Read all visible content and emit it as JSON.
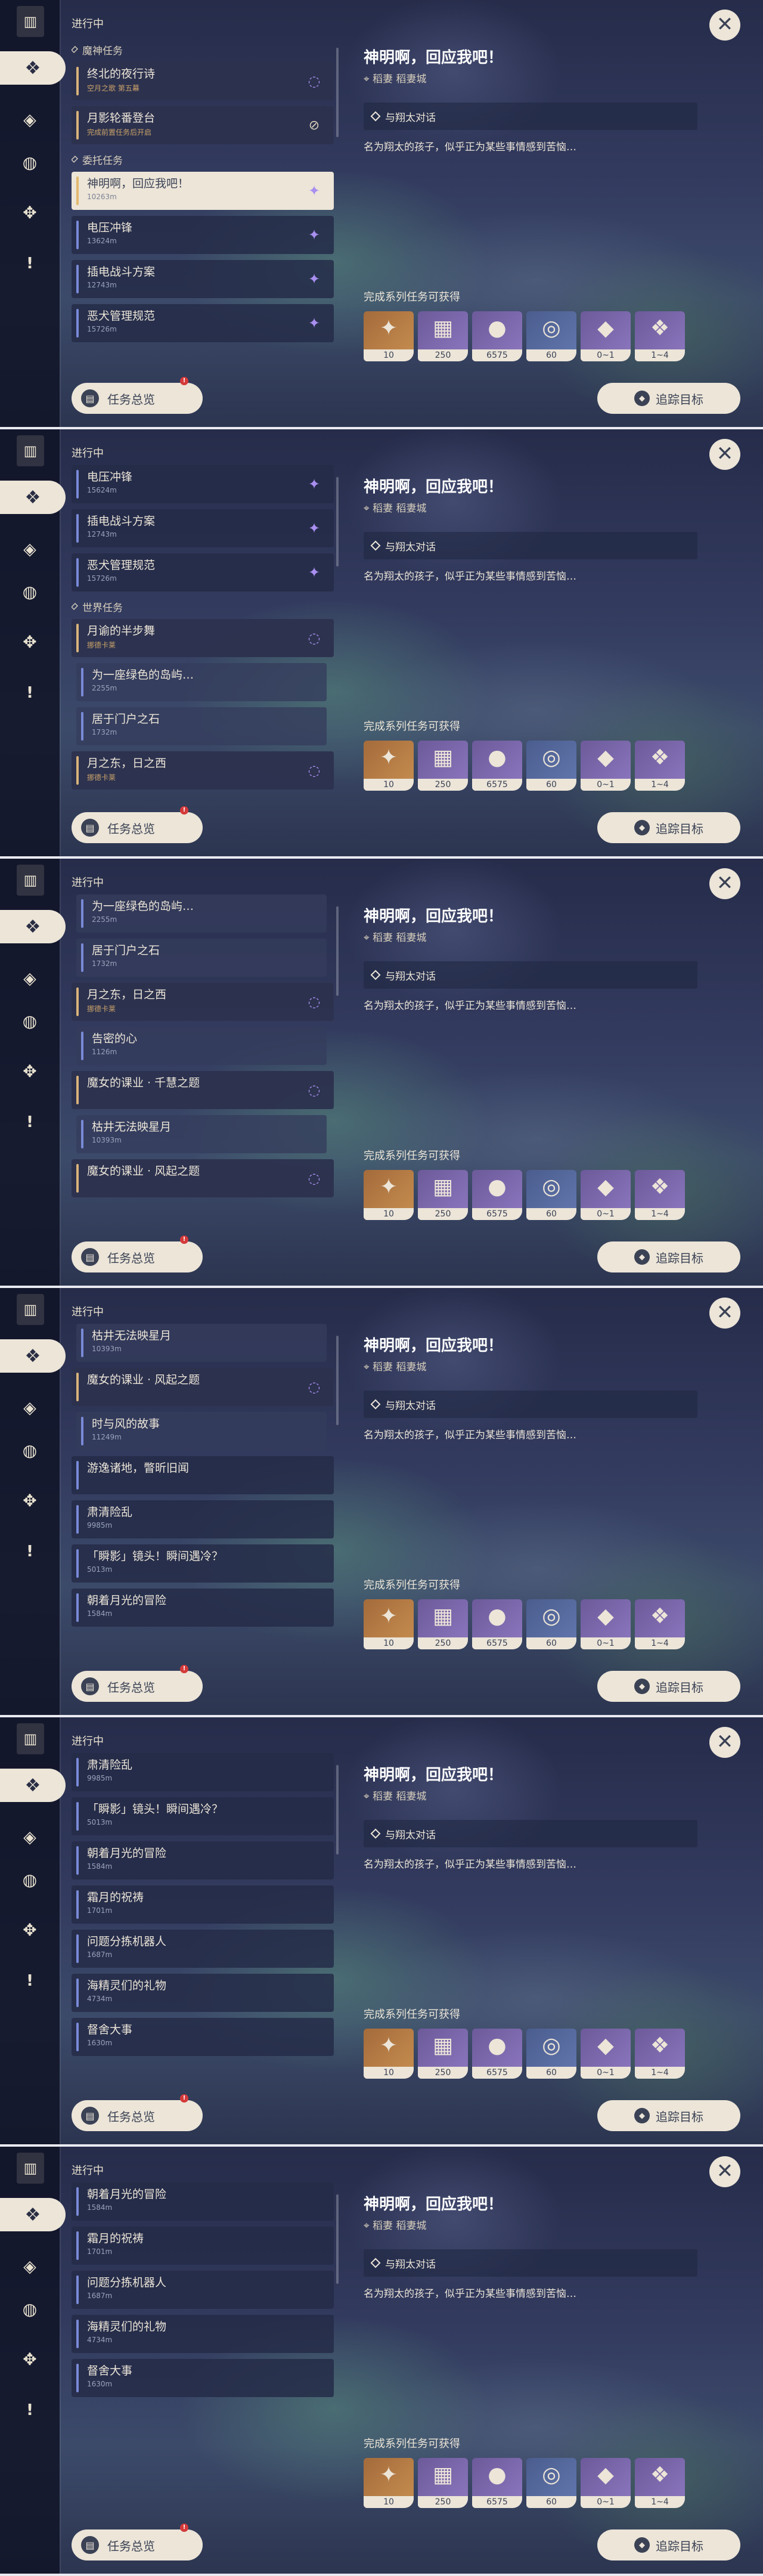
{
  "panels": [
    {
      "header": "进行中",
      "rows": [
        {
          "kind": "section",
          "label": "魔神任务"
        },
        {
          "kind": "card",
          "style": "arch",
          "title": "终北的夜行诗",
          "sub": "空月之歌 第五幕",
          "icon": "swirl"
        },
        {
          "kind": "card",
          "style": "arch",
          "title": "月影轮番登台",
          "sub": "完成前置任务后开启",
          "icon": "block"
        },
        {
          "kind": "section",
          "label": "委托任务"
        },
        {
          "kind": "card",
          "style": "sel",
          "title": "神明啊，回应我吧！",
          "sub": "10263m",
          "icon": "gem"
        },
        {
          "kind": "card",
          "title": "电压冲锋",
          "sub": "13624m",
          "icon": "gem"
        },
        {
          "kind": "card",
          "title": "插电战斗方案",
          "sub": "12743m",
          "icon": "gem"
        },
        {
          "kind": "card",
          "title": "恶犬管理规范",
          "sub": "15726m",
          "icon": "gem"
        }
      ]
    },
    {
      "header": "进行中",
      "rows": [
        {
          "kind": "card",
          "title": "电压冲锋",
          "sub": "15624m",
          "icon": "gem"
        },
        {
          "kind": "card",
          "title": "插电战斗方案",
          "sub": "12743m",
          "icon": "gem"
        },
        {
          "kind": "card",
          "title": "恶犬管理规范",
          "sub": "15726m",
          "icon": "gem"
        },
        {
          "kind": "section",
          "label": "世界任务"
        },
        {
          "kind": "card",
          "style": "arch",
          "title": "月谕的半步舞",
          "sub": "挪德卡莱",
          "icon": "swirl"
        },
        {
          "kind": "card",
          "style": "sub",
          "title": "为一座绿色的岛屿…",
          "sub": "2255m",
          "icon": "loc"
        },
        {
          "kind": "card",
          "style": "sub",
          "title": "居于门户之石",
          "sub": "1732m",
          "icon": "loc"
        },
        {
          "kind": "card",
          "style": "arch",
          "title": "月之东，日之西",
          "sub": "挪德卡莱",
          "icon": "swirl"
        }
      ]
    },
    {
      "header": "进行中",
      "rows": [
        {
          "kind": "card",
          "style": "sub",
          "title": "为一座绿色的岛屿…",
          "sub": "2255m",
          "icon": "loc"
        },
        {
          "kind": "card",
          "style": "sub",
          "title": "居于门户之石",
          "sub": "1732m",
          "icon": "loc"
        },
        {
          "kind": "card",
          "style": "arch",
          "title": "月之东，日之西",
          "sub": "挪德卡莱",
          "icon": "swirl"
        },
        {
          "kind": "card",
          "style": "sub",
          "title": "告密的心",
          "sub": "1126m",
          "icon": "loc"
        },
        {
          "kind": "card",
          "style": "arch",
          "title": "魔女的课业 · 千慧之题",
          "sub": "",
          "icon": "swirl"
        },
        {
          "kind": "card",
          "style": "sub",
          "title": "枯井无法映星月",
          "sub": "10393m",
          "icon": "loc"
        },
        {
          "kind": "card",
          "style": "arch",
          "title": "魔女的课业 · 风起之题",
          "sub": "",
          "icon": "swirl"
        }
      ]
    },
    {
      "header": "进行中",
      "rows": [
        {
          "kind": "card",
          "style": "sub",
          "title": "枯井无法映星月",
          "sub": "10393m",
          "icon": "loc"
        },
        {
          "kind": "card",
          "style": "arch",
          "title": "魔女的课业 · 风起之题",
          "sub": "",
          "icon": "swirl"
        },
        {
          "kind": "card",
          "style": "sub",
          "title": "时与风的故事",
          "sub": "11249m",
          "icon": "loc"
        },
        {
          "kind": "card",
          "title": "游逸诸地，瞥昕旧闻",
          "sub": "",
          "icon": "loc"
        },
        {
          "kind": "card",
          "title": "肃清险乱",
          "sub": "9985m",
          "icon": "loc"
        },
        {
          "kind": "card",
          "title": "「瞬影」镜头！瞬间遇冷？",
          "sub": "5013m",
          "icon": "loc"
        },
        {
          "kind": "card",
          "title": "朝着月光的冒险",
          "sub": "1584m",
          "icon": "loc"
        }
      ]
    },
    {
      "header": "进行中",
      "rows": [
        {
          "kind": "card",
          "title": "肃清险乱",
          "sub": "9985m",
          "icon": "loc"
        },
        {
          "kind": "card",
          "title": "「瞬影」镜头！瞬间遇冷？",
          "sub": "5013m",
          "icon": "loc"
        },
        {
          "kind": "card",
          "title": "朝着月光的冒险",
          "sub": "1584m",
          "icon": "loc"
        },
        {
          "kind": "card",
          "title": "霜月的祝祷",
          "sub": "1701m",
          "icon": "loc"
        },
        {
          "kind": "card",
          "title": "问题分拣机器人",
          "sub": "1687m",
          "icon": "loc"
        },
        {
          "kind": "card",
          "title": "海精灵们的礼物",
          "sub": "4734m",
          "icon": "loc"
        },
        {
          "kind": "card",
          "title": "督舍大事",
          "sub": "1630m",
          "icon": "loc"
        }
      ]
    },
    {
      "header": "进行中",
      "rows": [
        {
          "kind": "card",
          "title": "朝着月光的冒险",
          "sub": "1584m",
          "icon": "loc"
        },
        {
          "kind": "card",
          "title": "霜月的祝祷",
          "sub": "1701m",
          "icon": "loc"
        },
        {
          "kind": "card",
          "title": "问题分拣机器人",
          "sub": "1687m",
          "icon": "loc"
        },
        {
          "kind": "card",
          "title": "海精灵们的礼物",
          "sub": "4734m",
          "icon": "loc"
        },
        {
          "kind": "card",
          "title": "督舍大事",
          "sub": "1630m",
          "icon": "loc"
        }
      ]
    }
  ],
  "detail": {
    "title": "神明啊，回应我吧！",
    "location": "稻妻  稻妻城",
    "objective": "与翔太对话",
    "description": "名为翔太的孩子，似乎正为某些事情感到苦恼…",
    "rewards_label": "完成系列任务可获得",
    "rewards": [
      {
        "icon": "primogem-icon",
        "glyph": "✦",
        "count": "10",
        "style": "gold"
      },
      {
        "icon": "adventure-exp-icon",
        "glyph": "▦",
        "count": "250",
        "style": "purple"
      },
      {
        "icon": "mora-icon",
        "glyph": "●",
        "count": "6575",
        "style": "purple"
      },
      {
        "icon": "companionship-exp-icon",
        "glyph": "◎",
        "count": "60",
        "style": "blue"
      },
      {
        "icon": "crystal-icon",
        "glyph": "◆",
        "count": "0~1",
        "style": "purple"
      },
      {
        "icon": "enhancement-ore-icon",
        "glyph": "❖",
        "count": "1~4",
        "style": "purple"
      }
    ]
  },
  "buttons": {
    "overview": "任务总览",
    "track": "追踪目标",
    "close": "✕"
  },
  "colors": {
    "accent": "#ece5d8",
    "selected_bar": "#e3b96c",
    "commission_gem": "#a98ff0",
    "notification": "#d43a3a"
  }
}
